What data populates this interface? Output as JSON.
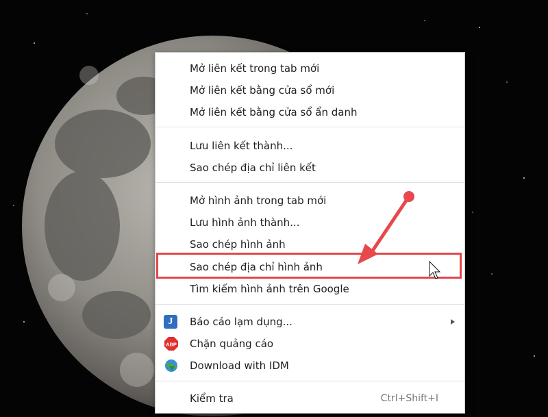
{
  "menu": {
    "items": [
      {
        "label": "Mở liên kết trong tab mới"
      },
      {
        "label": "Mở liên kết bằng cửa sổ mới"
      },
      {
        "label": "Mở liên kết bằng cửa sổ ẩn danh"
      },
      {
        "label": "Lưu liên kết thành..."
      },
      {
        "label": "Sao chép địa chỉ liên kết"
      },
      {
        "label": "Mở hình ảnh trong tab mới"
      },
      {
        "label": "Lưu hình ảnh thành..."
      },
      {
        "label": "Sao chép hình ảnh"
      },
      {
        "label": "Sao chép địa chỉ hình ảnh"
      },
      {
        "label": "Tìm kiếm hình ảnh trên Google"
      },
      {
        "label": "Báo cáo lạm dụng...",
        "icon": "report-abuse-icon"
      },
      {
        "label": "Chặn quảng cáo",
        "icon": "adblock-plus-icon",
        "icon_text": "ABP"
      },
      {
        "label": "Download with IDM",
        "icon": "idm-globe-icon"
      },
      {
        "label": "Kiểm tra",
        "shortcut": "Ctrl+Shift+I"
      }
    ]
  },
  "colors": {
    "highlight_border": "#e2484c",
    "arrow": "#e8474b",
    "menu_bg": "#ffffff"
  }
}
